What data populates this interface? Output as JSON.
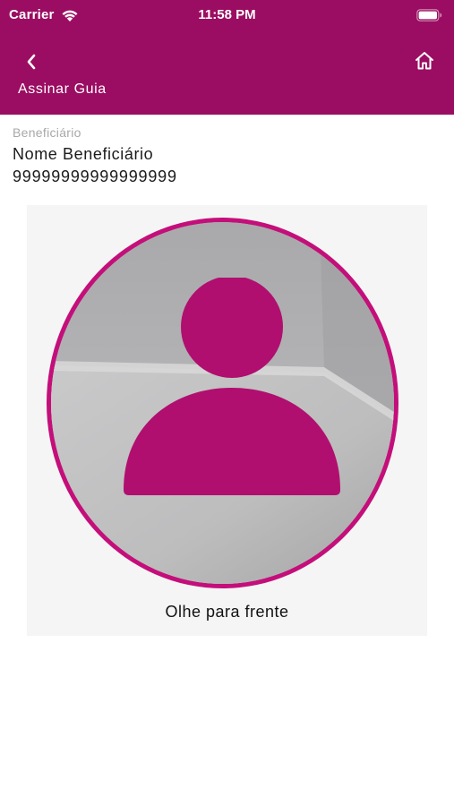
{
  "status_bar": {
    "carrier": "Carrier",
    "time": "11:58 PM",
    "wifi_icon": "wifi-icon",
    "battery_icon": "battery-icon"
  },
  "nav": {
    "title": "Assinar Guia",
    "back_icon": "chevron-left-icon",
    "home_icon": "home-icon"
  },
  "beneficiary": {
    "label": "Beneficiário",
    "name": "Nome Beneficiário",
    "number": "99999999999999999"
  },
  "camera": {
    "overlay_icon": "user-silhouette-icon",
    "instruction": "Olhe para frente"
  },
  "colors": {
    "brand": "#9b0d62",
    "accent": "#c40f7a",
    "silhouette": "#b00f6f",
    "background": "#ffffff"
  }
}
